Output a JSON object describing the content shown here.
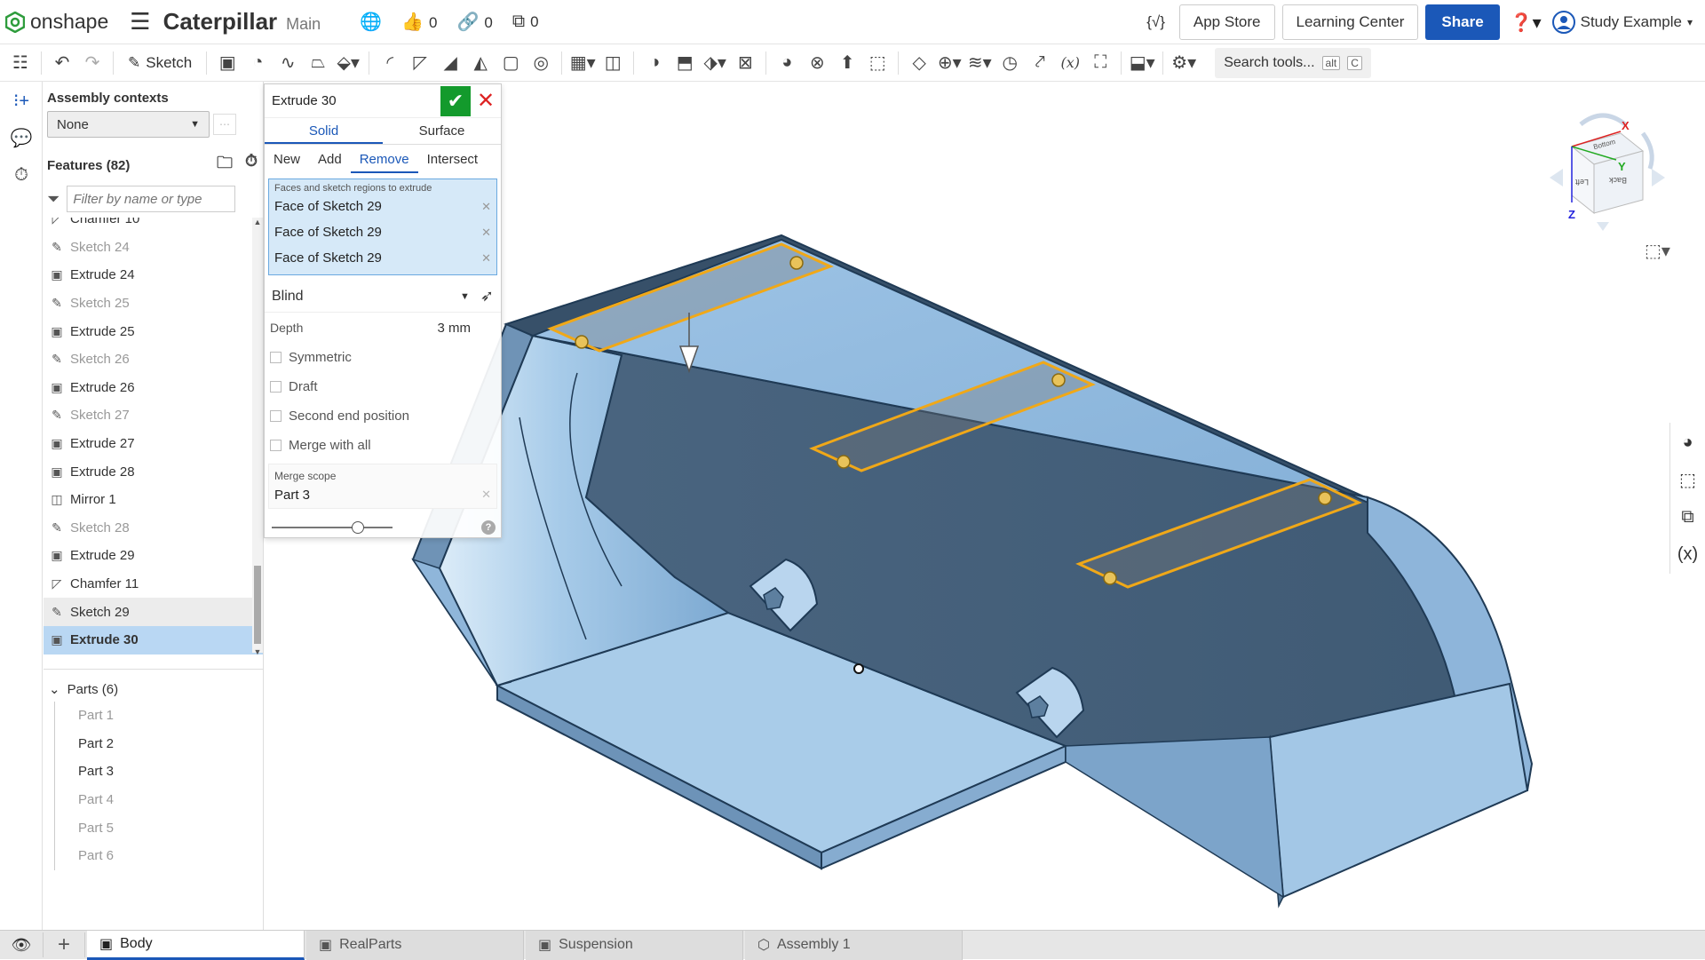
{
  "app": {
    "logo_text": "onshape",
    "doc_title": "Caterpillar",
    "branch": "Main",
    "likes": "0",
    "links": "0",
    "copies": "0"
  },
  "topbar": {
    "app_store": "App Store",
    "learning_center": "Learning Center",
    "share": "Share",
    "user": "Study Example",
    "variables_glyph": "{√}"
  },
  "toolbar": {
    "sketch": "Sketch",
    "search": "Search tools...",
    "search_kbd1": "alt",
    "search_kbd2": "C"
  },
  "panel": {
    "assembly_contexts": "Assembly contexts",
    "context_value": "None",
    "features_title": "Features (82)",
    "filter_placeholder": "Filter by name or type",
    "features": [
      {
        "label": "Chamfer 10",
        "icon": "chamfer-icon",
        "dim": false
      },
      {
        "label": "Sketch 24",
        "icon": "sketch-icon",
        "dim": true
      },
      {
        "label": "Extrude 24",
        "icon": "extrude-icon",
        "dim": false
      },
      {
        "label": "Sketch 25",
        "icon": "sketch-icon",
        "dim": true
      },
      {
        "label": "Extrude 25",
        "icon": "extrude-icon",
        "dim": false
      },
      {
        "label": "Sketch 26",
        "icon": "sketch-icon",
        "dim": true
      },
      {
        "label": "Extrude 26",
        "icon": "extrude-icon",
        "dim": false
      },
      {
        "label": "Sketch 27",
        "icon": "sketch-icon",
        "dim": true
      },
      {
        "label": "Extrude 27",
        "icon": "extrude-icon",
        "dim": false
      },
      {
        "label": "Extrude 28",
        "icon": "extrude-icon",
        "dim": false
      },
      {
        "label": "Mirror 1",
        "icon": "mirror-icon",
        "dim": false
      },
      {
        "label": "Sketch 28",
        "icon": "sketch-icon",
        "dim": true
      },
      {
        "label": "Extrude 29",
        "icon": "extrude-icon",
        "dim": false
      },
      {
        "label": "Chamfer 11",
        "icon": "chamfer-icon",
        "dim": false
      },
      {
        "label": "Sketch 29",
        "icon": "sketch-icon",
        "dim": false
      },
      {
        "label": "Extrude 30",
        "icon": "extrude-icon",
        "dim": false
      }
    ],
    "parts_title": "Parts (6)",
    "parts": [
      "Part 1",
      "Part 2",
      "Part 3",
      "Part 4",
      "Part 5",
      "Part 6"
    ]
  },
  "dialog": {
    "title": "Extrude 30",
    "tab_solid": "Solid",
    "tab_surface": "Surface",
    "op_new": "New",
    "op_add": "Add",
    "op_remove": "Remove",
    "op_intersect": "Intersect",
    "faces_caption": "Faces and sketch regions to extrude",
    "faces": [
      "Face of Sketch 29",
      "Face of Sketch 29",
      "Face of Sketch 29"
    ],
    "end_type": "Blind",
    "depth_label": "Depth",
    "depth_value": "3 mm",
    "symmetric": "Symmetric",
    "draft": "Draft",
    "second_end": "Second end position",
    "merge_all": "Merge with all",
    "merge_scope_label": "Merge scope",
    "merge_scope_value": "Part 3"
  },
  "viewcube": {
    "x": "X",
    "y": "Y",
    "z": "Z",
    "top": "Bottom",
    "left": "Left",
    "back": "Back"
  },
  "bottom_tabs": [
    "Body",
    "RealParts",
    "Suspension",
    "Assembly 1"
  ],
  "colors": {
    "accent": "#1b58b8",
    "model": "#8fb8de",
    "selection": "#f0a818"
  }
}
